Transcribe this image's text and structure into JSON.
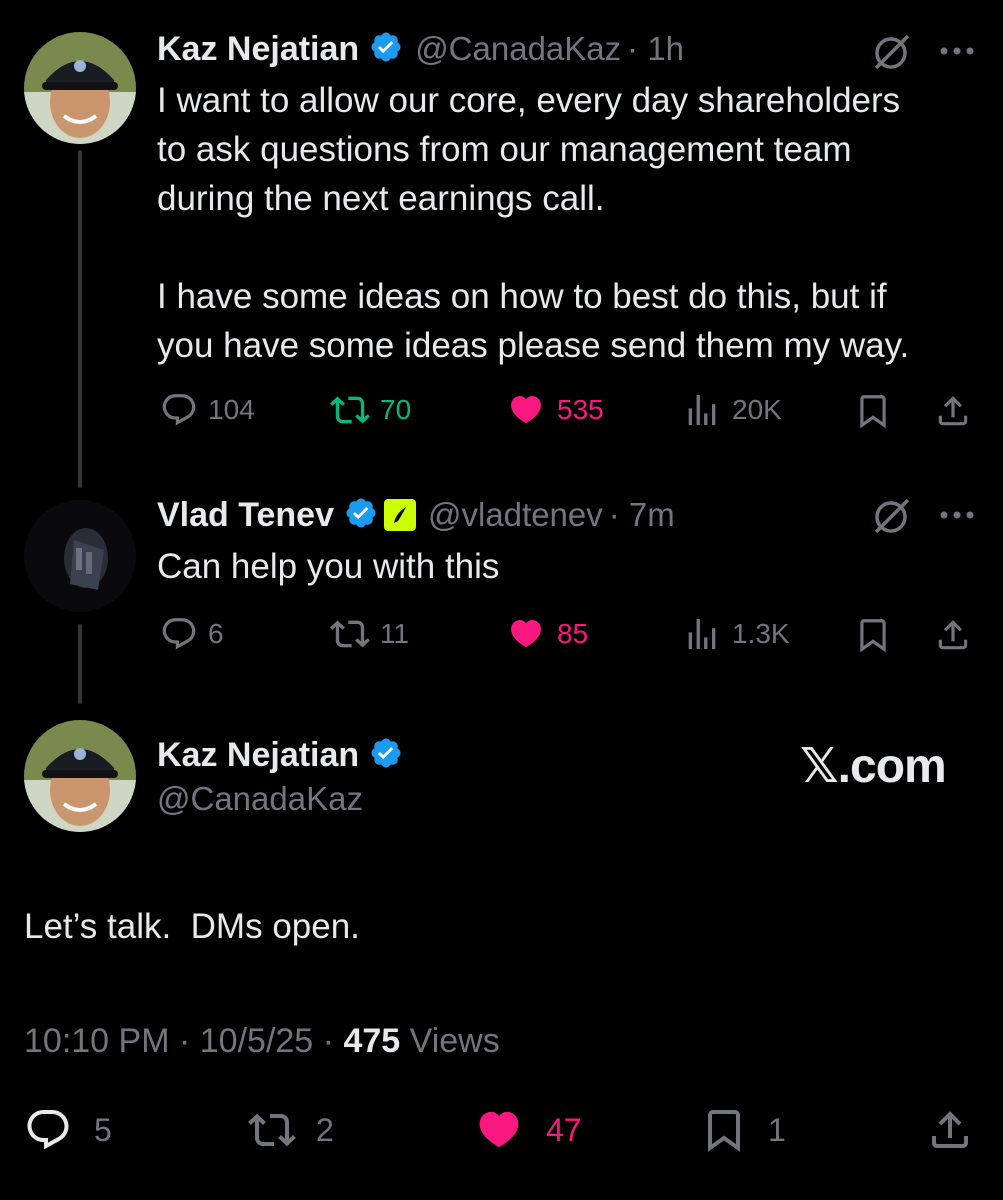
{
  "tweet1": {
    "name": "Kaz Nejatian",
    "handle": "@CanadaKaz",
    "time": "· 1h",
    "text_lines": [
      "I want to allow our core, every day shareholders",
      "to ask questions from our management team",
      "during the next earnings call.",
      "",
      "I have some ideas on how to best do this, but if",
      "you have some ideas please send them my way."
    ],
    "replies": "104",
    "retweets": "70",
    "likes": "535",
    "views": "20K"
  },
  "tweet2": {
    "name": "Vlad Tenev",
    "handle": "@vladtenev",
    "time": "· 7m",
    "text": "Can help you with this",
    "replies": "6",
    "retweets": "11",
    "likes": "85",
    "views": "1.3K"
  },
  "main": {
    "name": "Kaz Nejatian",
    "handle": "@CanadaKaz",
    "brand": "𝕏.com",
    "text": "Let’s talk.  DMs open.",
    "time": "10:10 PM",
    "date": "10/5/25",
    "views_count": "475",
    "views_label": "Views",
    "sep": "·",
    "replies": "5",
    "retweets": "2",
    "likes": "47",
    "bookmarks": "1"
  },
  "colors": {
    "background": "#000000",
    "text": "#e7e9ea",
    "muted": "#71767b",
    "verified": "#1d9bf0",
    "like": "#f91880",
    "retweet_active": "#00ba7c",
    "robinhood": "#ccff00"
  },
  "icons": [
    "reply-icon",
    "retweet-icon",
    "heart-icon",
    "views-icon",
    "bookmark-icon",
    "share-icon",
    "grok-icon",
    "more-icon",
    "verified-icon"
  ]
}
